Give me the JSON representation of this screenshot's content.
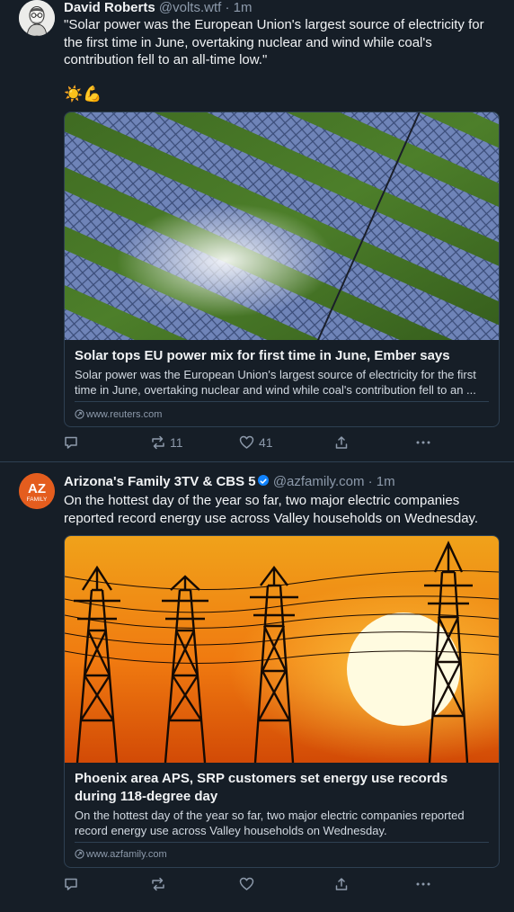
{
  "posts": [
    {
      "author": "David Roberts",
      "handle": "@volts.wtf",
      "separator": "·",
      "time": "1m",
      "text": "\"Solar power was the European Union's largest source of electricity for the first time in June, overtaking nuclear and wind while coal's contribution fell to an all-time low.\"",
      "emoji": "☀️💪",
      "card": {
        "title": "Solar tops EU power mix for first time in June, Ember says",
        "description": "Solar power was the European Union's largest source of electricity for the first time in June, overtaking nuclear and wind while coal's contribution fell to an ...",
        "domain": "www.reuters.com"
      },
      "actions": {
        "replies": "",
        "reposts": "11",
        "likes": "41"
      }
    },
    {
      "author": "Arizona's Family 3TV & CBS 5",
      "handle": "@azfamily.com",
      "separator": "·",
      "time": "1m",
      "avatar_text_top": "AZ",
      "avatar_text_bottom": "FAMILY",
      "text": "On the hottest day of the year so far, two major electric companies reported record energy use across Valley households on Wednesday.",
      "card": {
        "title": "Phoenix area APS, SRP customers set energy use records during 118-degree day",
        "description": "On the hottest day of the year so far, two major electric companies reported record energy use across Valley households on Wednesday.",
        "domain": "www.azfamily.com"
      },
      "actions": {
        "replies": "",
        "reposts": "",
        "likes": ""
      }
    }
  ],
  "colors": {
    "background": "#161e27",
    "text": "#f1f3f5",
    "muted": "#8d9aab",
    "border": "#2e4052",
    "verified": "#1083fe"
  },
  "icons": [
    "reply-icon",
    "repost-icon",
    "like-icon",
    "share-icon",
    "more-icon",
    "link-icon",
    "verified-badge-icon"
  ]
}
